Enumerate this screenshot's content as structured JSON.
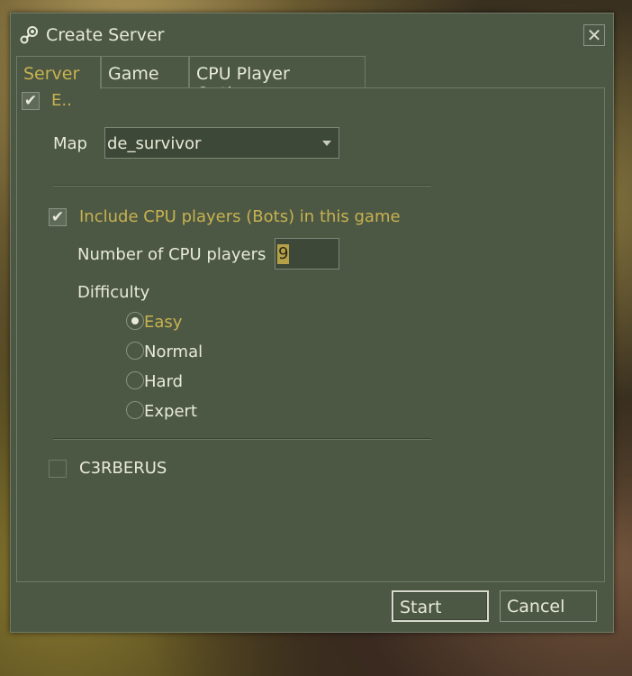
{
  "window": {
    "title": "Create Server",
    "close_glyph": "✕",
    "icon": "steam-icon"
  },
  "tabs": [
    {
      "label": "Server",
      "active": true
    },
    {
      "label": "Game",
      "active": false
    },
    {
      "label": "CPU Player Options",
      "active": false
    }
  ],
  "enable_checkbox": {
    "label": "E..",
    "checked": true
  },
  "map": {
    "label": "Map",
    "value": "de_survivor"
  },
  "bots": {
    "include_label": "Include CPU players (Bots) in this game",
    "include_checked": true,
    "count_label": "Number of CPU players",
    "count_value": "9",
    "difficulty_label": "Difficulty",
    "difficulty_options": [
      {
        "label": "Easy",
        "selected": true
      },
      {
        "label": "Normal",
        "selected": false
      },
      {
        "label": "Hard",
        "selected": false
      },
      {
        "label": "Expert",
        "selected": false
      }
    ]
  },
  "cerberus": {
    "label": "C3RBERUS",
    "checked": false
  },
  "buttons": {
    "start": "Start",
    "cancel": "Cancel"
  },
  "colors": {
    "panel": "#4c5844",
    "accent_text": "#c8b250",
    "text": "#e8ead8"
  }
}
